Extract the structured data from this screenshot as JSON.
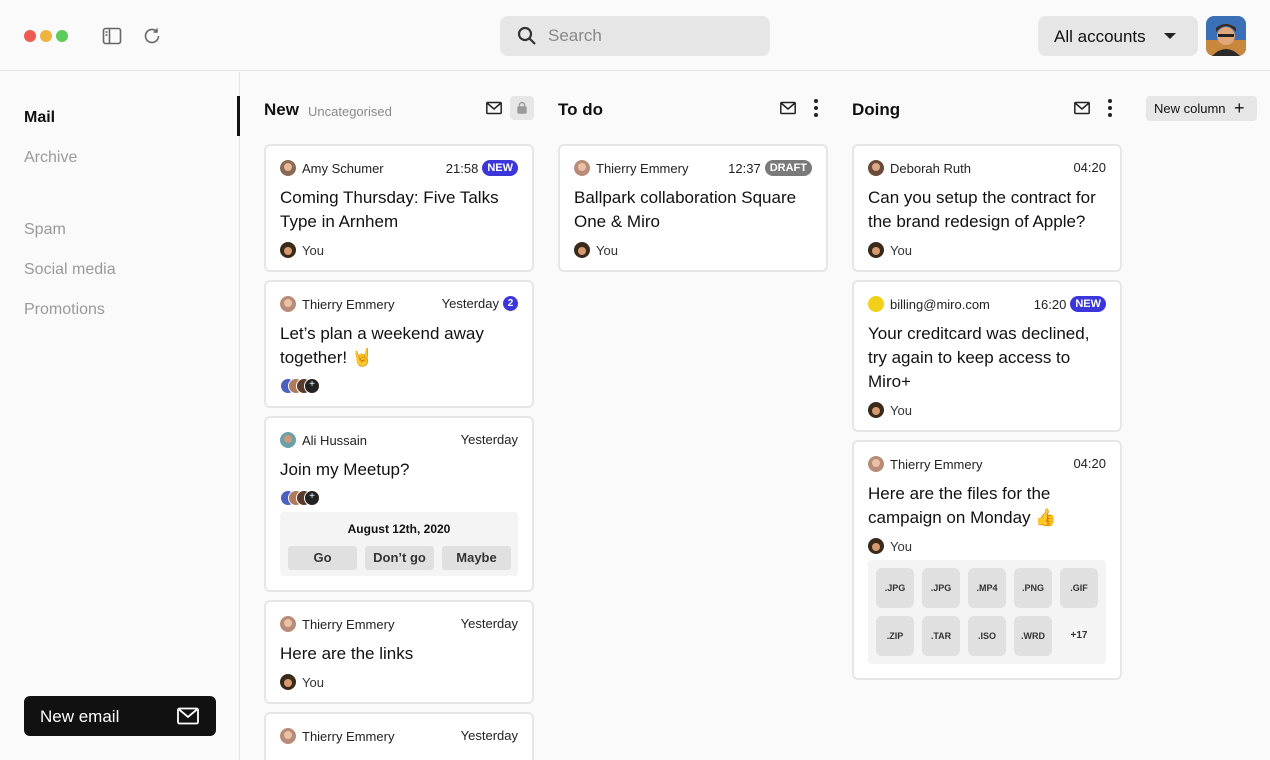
{
  "window": {
    "traffic_colors": [
      "#ed5a52",
      "#f0b33e",
      "#5dcb5b"
    ]
  },
  "header": {
    "search_placeholder": "Search",
    "account_selector": "All accounts"
  },
  "sidebar": {
    "items": [
      {
        "label": "Mail",
        "active": true
      },
      {
        "label": "Archive",
        "active": false
      },
      {
        "label": "Spam",
        "active": false
      },
      {
        "label": "Social media",
        "active": false
      },
      {
        "label": "Promotions",
        "active": false
      }
    ],
    "new_email_label": "New email"
  },
  "board": {
    "new_column_label": "New column",
    "columns": [
      {
        "title": "New",
        "subtitle": "Uncategorised",
        "cards": [
          {
            "sender": "Amy Schumer",
            "time": "21:58",
            "badge": "NEW",
            "subject": "Coming Thursday: Five Talks Type in Arnhem",
            "recipient": "You"
          },
          {
            "sender": "Thierry Emmery",
            "time": "Yesterday",
            "badge": "2",
            "subject": "Let’s plan a weekend away together! 🤘"
          },
          {
            "sender": "Ali Hussain",
            "time": "Yesterday",
            "subject": "Join my Meetup?",
            "event_date": "August 12th, 2020",
            "rsvp": [
              "Go",
              "Don’t go",
              "Maybe"
            ]
          },
          {
            "sender": "Thierry Emmery",
            "time": "Yesterday",
            "subject": "Here are the links",
            "recipient": "You"
          },
          {
            "sender": "Thierry Emmery",
            "time": "Yesterday"
          }
        ]
      },
      {
        "title": "To do",
        "cards": [
          {
            "sender": "Thierry Emmery",
            "time": "12:37",
            "badge": "DRAFT",
            "subject": "Ballpark collaboration Square One & Miro",
            "recipient": "You"
          }
        ]
      },
      {
        "title": "Doing",
        "cards": [
          {
            "sender": "Deborah Ruth",
            "time": "04:20",
            "subject": "Can you setup the contract for the brand redesign of Apple?",
            "recipient": "You"
          },
          {
            "sender": "billing@miro.com",
            "time": "16:20",
            "badge": "NEW",
            "subject": "Your creditcard was declined, try again to keep access to Miro+",
            "recipient": "You"
          },
          {
            "sender": "Thierry Emmery",
            "time": "04:20",
            "subject": "Here are the files for the campaign on Monday 👍",
            "recipient": "You",
            "attachments": [
              ".JPG",
              ".JPG",
              ".MP4",
              ".PNG",
              ".GIF",
              ".ZIP",
              ".TAR",
              ".ISO",
              ".WRD"
            ],
            "more_attachments": "+17"
          }
        ]
      }
    ]
  },
  "colors": {
    "accent_badge": "#3b36d9",
    "draft_badge": "#7a7a7a",
    "billing_dot": "#f2d01a"
  }
}
